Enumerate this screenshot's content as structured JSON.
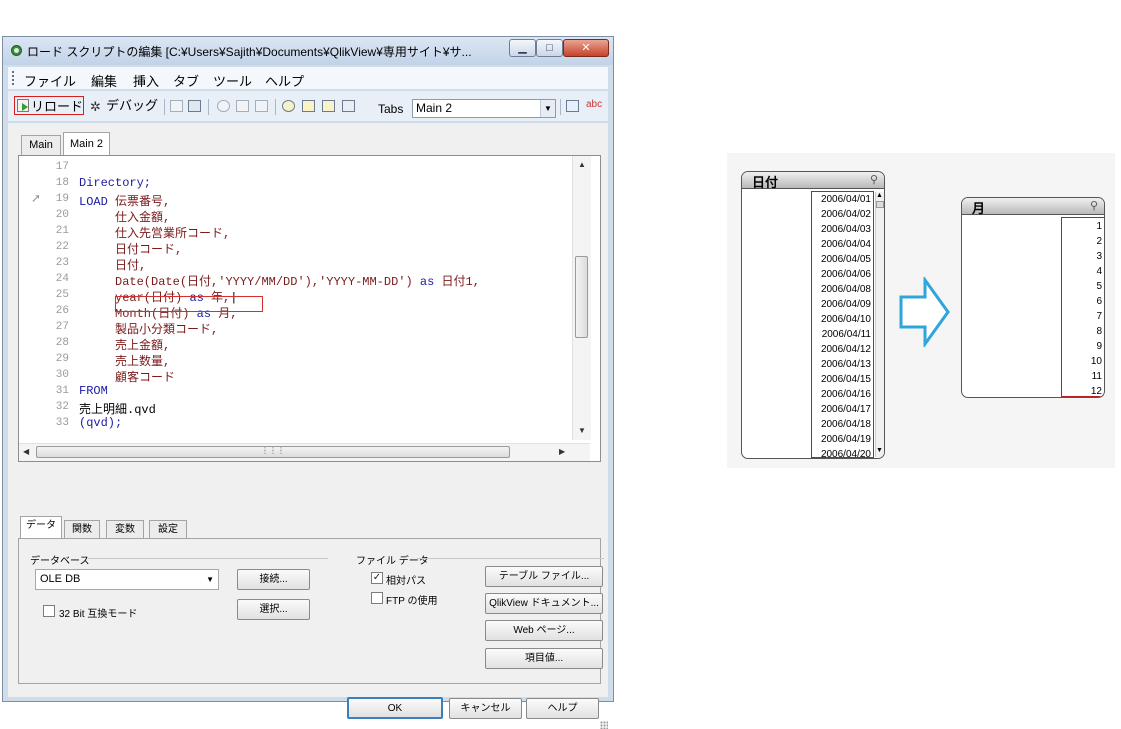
{
  "window": {
    "title": "ロード スクリプトの編集 [C:¥Users¥Sajith¥Documents¥QlikView¥専用サイト¥サ...",
    "controls": {
      "minimize": "▁",
      "maximize": "□",
      "close": "✕"
    }
  },
  "menu": [
    "ファイル",
    "編集",
    "挿入",
    "タブ",
    "ツール",
    "ヘルプ"
  ],
  "toolbar": {
    "reload": "リロード",
    "debug": "デバッグ",
    "tabs_label": "Tabs",
    "tabs_value": "Main 2"
  },
  "editor": {
    "tabs": [
      "Main",
      "Main 2"
    ],
    "active_tab": "Main 2",
    "lines": [
      {
        "n": "17",
        "parts": []
      },
      {
        "n": "18",
        "parts": [
          {
            "c": "kw",
            "t": "Directory;"
          }
        ]
      },
      {
        "n": "19",
        "parts": [
          {
            "c": "kw",
            "t": "LOAD "
          },
          {
            "c": "id",
            "t": "伝票番号,"
          }
        ]
      },
      {
        "n": "20",
        "parts": [
          {
            "c": "id",
            "t": "     仕入金額,"
          }
        ]
      },
      {
        "n": "21",
        "parts": [
          {
            "c": "id",
            "t": "     仕入先営業所コード,"
          }
        ]
      },
      {
        "n": "22",
        "parts": [
          {
            "c": "id",
            "t": "     日付コード,"
          }
        ]
      },
      {
        "n": "23",
        "parts": [
          {
            "c": "id",
            "t": "     日付,"
          }
        ]
      },
      {
        "n": "24",
        "parts": [
          {
            "c": "fn",
            "t": "     Date(Date("
          },
          {
            "c": "id",
            "t": "日付"
          },
          {
            "c": "str",
            "t": ",'YYYY/MM/DD'),'YYYY-MM-DD') "
          },
          {
            "c": "kw",
            "t": "as "
          },
          {
            "c": "id",
            "t": "日付1,"
          }
        ]
      },
      {
        "n": "25",
        "parts": [
          {
            "c": "fn",
            "t": "     year("
          },
          {
            "c": "id",
            "t": "日付"
          },
          {
            "c": "fn",
            "t": ") "
          },
          {
            "c": "kw",
            "t": "as "
          },
          {
            "c": "id",
            "t": "年,"
          },
          {
            "c": "plain",
            "t": "|"
          }
        ]
      },
      {
        "n": "26",
        "parts": [
          {
            "c": "fn",
            "t": "     Month("
          },
          {
            "c": "id",
            "t": "日付"
          },
          {
            "c": "fn",
            "t": ") "
          },
          {
            "c": "kw",
            "t": "as "
          },
          {
            "c": "id",
            "t": "月,"
          }
        ]
      },
      {
        "n": "27",
        "parts": [
          {
            "c": "id",
            "t": "     製品小分類コード,"
          }
        ]
      },
      {
        "n": "28",
        "parts": [
          {
            "c": "id",
            "t": "     売上金額,"
          }
        ]
      },
      {
        "n": "29",
        "parts": [
          {
            "c": "id",
            "t": "     売上数量,"
          }
        ]
      },
      {
        "n": "30",
        "parts": [
          {
            "c": "id",
            "t": "     顧客コード"
          }
        ]
      },
      {
        "n": "31",
        "parts": [
          {
            "c": "kw",
            "t": "FROM"
          }
        ]
      },
      {
        "n": "32",
        "parts": [
          {
            "c": "plain",
            "t": "売上明細.qvd"
          }
        ]
      },
      {
        "n": "33",
        "parts": [
          {
            "c": "kw",
            "t": "(qvd);"
          }
        ]
      }
    ]
  },
  "bottom_tabs": [
    "データ",
    "関数",
    "変数",
    "設定"
  ],
  "panel": {
    "database_group": "データベース",
    "database_value": "OLE DB",
    "connect": "接続...",
    "select": "選択...",
    "bit32_label": "32 Bit 互換モード",
    "file_data_group": "ファイル データ",
    "relative_path": "相対パス",
    "relative_path_checked": true,
    "ftp_label": "FTP の使用",
    "ftp_checked": false,
    "table_file": "テーブル ファイル...",
    "qlikview_doc": "QlikView ドキュメント...",
    "web_page": "Web ページ...",
    "field_value": "項目値..."
  },
  "dialog_buttons": {
    "ok": "OK",
    "cancel": "キャンセル",
    "help": "ヘルプ"
  },
  "listbox_date": {
    "title": "日付",
    "values": [
      "2006/04/01",
      "2006/04/02",
      "2006/04/03",
      "2006/04/04",
      "2006/04/05",
      "2006/04/06",
      "2006/04/08",
      "2006/04/09",
      "2006/04/10",
      "2006/04/11",
      "2006/04/12",
      "2006/04/13",
      "2006/04/15",
      "2006/04/16",
      "2006/04/17",
      "2006/04/18",
      "2006/04/19",
      "2006/04/20"
    ]
  },
  "listbox_month": {
    "title": "月",
    "values": [
      "1",
      "2",
      "3",
      "4",
      "5",
      "6",
      "7",
      "8",
      "9",
      "10",
      "11",
      "12"
    ]
  },
  "colors": {
    "highlight_red": "#d43030",
    "arrow_blue": "#2ea6dc"
  }
}
